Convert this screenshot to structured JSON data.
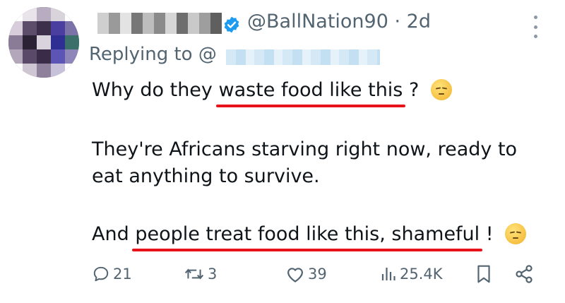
{
  "tweet": {
    "handle": "@BallNation90",
    "dot": "·",
    "age": "2d",
    "replying_prefix": "Replying to @",
    "lines": {
      "l1a": "Why do they",
      "l1b": "waste food like this",
      "l1c": "?",
      "l2": "They're  Africans starving right now, ready to",
      "l3": "eat anything to survive.",
      "l4a": "And",
      "l4b": "people treat food like this, shameful",
      "l4c": "!"
    },
    "emojis": [
      "disappointed-face",
      "pensive-face"
    ]
  },
  "actions": {
    "replies": "21",
    "reposts": "3",
    "likes": "39",
    "views": "25.4K"
  },
  "colors": {
    "text": "#0f1419",
    "secondary": "#536471",
    "verified": "#1d9bf0",
    "underline": "#e8131a"
  }
}
